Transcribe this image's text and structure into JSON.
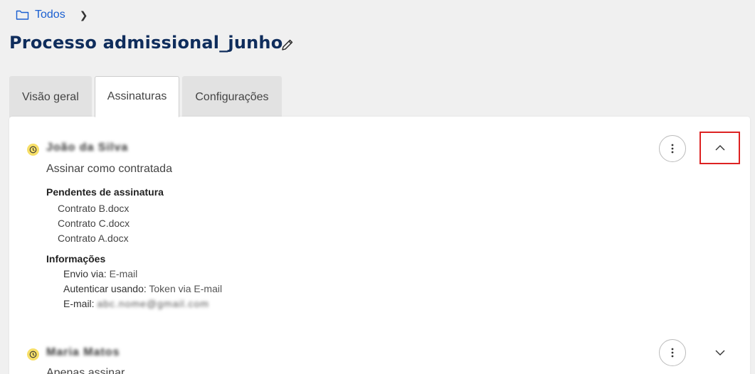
{
  "breadcrumb": {
    "root": "Todos",
    "icon": "folder-icon"
  },
  "page": {
    "title": "Processo admissional_junho"
  },
  "tabs": [
    {
      "label": "Visão geral",
      "active": false
    },
    {
      "label": "Assinaturas",
      "active": true
    },
    {
      "label": "Configurações",
      "active": false
    }
  ],
  "signers": [
    {
      "name": "João da Silva",
      "role": "Assinar como contratada",
      "status_color": "#f7df68",
      "expanded": true,
      "pending_title": "Pendentes de assinatura",
      "documents": [
        "Contrato B.docx",
        "Contrato C.docx",
        "Contrato A.docx"
      ],
      "info_title": "Informações",
      "info": {
        "envio_label": "Envio via:",
        "envio_value": "E-mail",
        "auth_label": "Autenticar usando:",
        "auth_value": "Token via E-mail",
        "email_label": "E-mail:",
        "email_value": "abc.nome@gmail.com"
      }
    },
    {
      "name": "Maria Matos",
      "role": "Apenas assinar",
      "status_color": "#f7df68",
      "expanded": false
    }
  ],
  "colors": {
    "link": "#1a5fd1",
    "title": "#0f2d5c",
    "highlight": "#dd2222"
  }
}
